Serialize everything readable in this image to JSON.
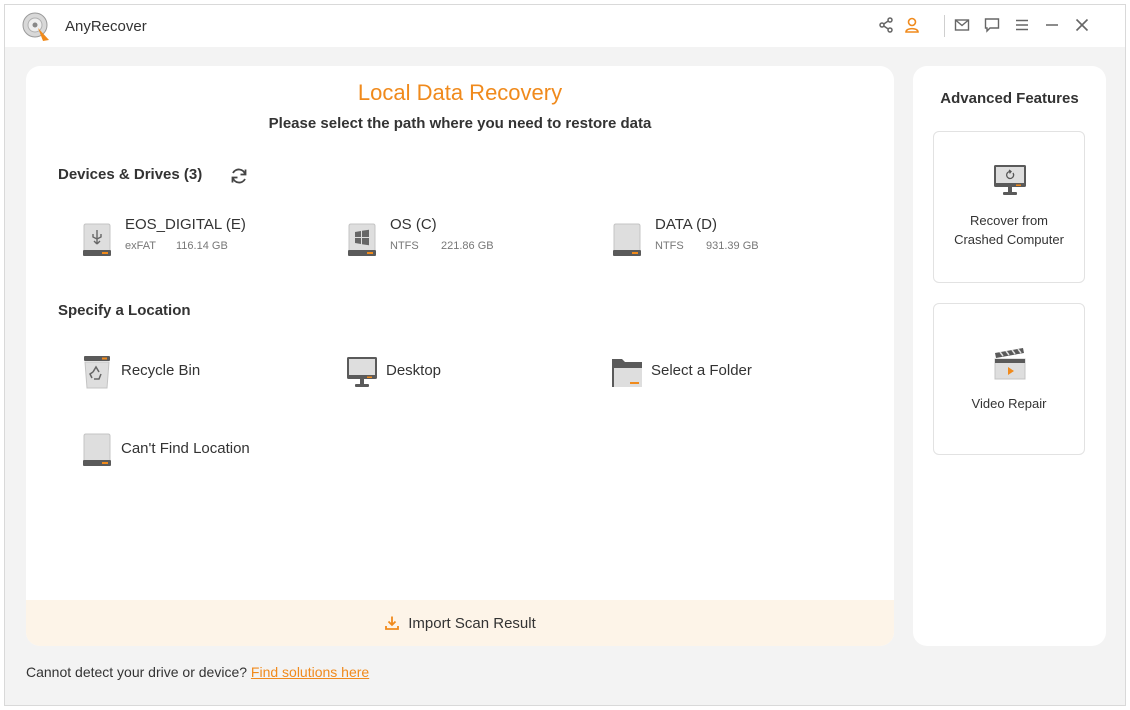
{
  "app": {
    "title": "AnyRecover"
  },
  "titlebar": {
    "icons": [
      "share-icon",
      "user-icon",
      "mail-icon",
      "feedback-icon",
      "menu-icon",
      "minimize-icon",
      "close-icon"
    ]
  },
  "colors": {
    "accent": "#f08a1c",
    "window_bg": "#f3f3f3",
    "import_bg": "#fdf4e8"
  },
  "main": {
    "title": "Local Data Recovery",
    "subtitle": "Please select the path where you need to restore data",
    "devices_title": "Devices & Drives (3)",
    "drives": [
      {
        "name": "EOS_DIGITAL (E)",
        "fs": "exFAT",
        "size": "116.14 GB",
        "icon": "usb-drive-icon"
      },
      {
        "name": "OS (C)",
        "fs": "NTFS",
        "size": "221.86 GB",
        "icon": "windows-drive-icon"
      },
      {
        "name": "DATA (D)",
        "fs": "NTFS",
        "size": "931.39 GB",
        "icon": "hard-drive-icon"
      }
    ],
    "location_title": "Specify a Location",
    "locations": [
      {
        "label": "Recycle Bin",
        "icon": "recycle-bin-icon"
      },
      {
        "label": "Desktop",
        "icon": "desktop-icon"
      },
      {
        "label": "Select a Folder",
        "icon": "folder-icon"
      },
      {
        "label": "Can't Find Location",
        "icon": "unknown-drive-icon"
      }
    ],
    "import_label": "Import Scan Result"
  },
  "side": {
    "title": "Advanced Features",
    "features": [
      {
        "line1": "Recover from",
        "line2": "Crashed Computer",
        "icon": "crashed-computer-icon"
      },
      {
        "line1": "Video Repair",
        "line2": "",
        "icon": "clapperboard-icon"
      }
    ]
  },
  "footer": {
    "text": "Cannot detect your drive or device?",
    "link": "Find solutions here"
  }
}
